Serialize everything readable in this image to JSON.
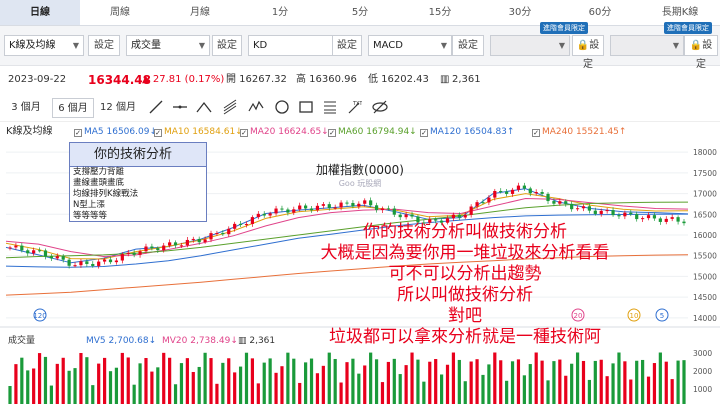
{
  "tabs": [
    {
      "label": "日線",
      "active": true
    },
    {
      "label": "周線",
      "active": false
    },
    {
      "label": "月線",
      "active": false
    },
    {
      "label": "1分",
      "active": false
    },
    {
      "label": "5分",
      "active": false
    },
    {
      "label": "15分",
      "active": false
    },
    {
      "label": "30分",
      "active": false
    },
    {
      "label": "60分",
      "active": false
    },
    {
      "label": "長期K線",
      "active": false
    }
  ],
  "selectors": {
    "s1": "K線及均線",
    "s2": "成交量",
    "s3": "KD",
    "s4": "MACD",
    "setting": "設定",
    "member_badge": "進階會員限定"
  },
  "quote": {
    "date": "2023-09-22",
    "price": "16344.48",
    "change": "▲ 27.81 (0.17%)",
    "open": "開 16267.32",
    "high": "高 16360.96",
    "low": "低 16202.43",
    "volume": "2,361"
  },
  "ranges": [
    "3 個月",
    "6 個月",
    "12 個月"
  ],
  "ma": {
    "label": "K線及均線",
    "items": [
      {
        "text": "MA5 16506.09↓",
        "color": "#2f6fd0"
      },
      {
        "text": "MA10 16584.61↓",
        "color": "#e0a010"
      },
      {
        "text": "MA20 16624.65↓",
        "color": "#e0448a"
      },
      {
        "text": "MA60 16794.94↓",
        "color": "#5aa02c"
      },
      {
        "text": "MA120 16504.83↑",
        "color": "#2f6fd0"
      },
      {
        "text": "MA240 15521.45↑",
        "color": "#e8703a"
      }
    ]
  },
  "dropdown": {
    "header": "你的技術分析",
    "items": [
      "支撐壓力背離",
      "畫線畫頭畫底",
      "均線排列K線戰法",
      "N型上漲",
      "等等等等"
    ]
  },
  "chart_title": "加權指數(0000)",
  "watermark": "Goo 玩股網",
  "volume_panel": {
    "label": "成交量",
    "mv5": "MV5 2,700.68↓",
    "mv20": "MV20 2,738.49↓",
    "vol": "2,361"
  },
  "overlay": [
    "你的技術分析叫做技術分析",
    "大概是因為要你用一堆垃圾來分析看看",
    "可不可以分析出趨勢",
    "所以叫做技術分析",
    "對吧",
    "垃圾都可以拿來分析就是一種技術阿"
  ],
  "colors": {
    "up": "#e8001c",
    "down": "#1a9a3a",
    "tab_active": "#dfe6f2"
  },
  "chart_data": {
    "type": "line",
    "y_ticks": [
      14000,
      14500,
      15000,
      15500,
      16000,
      16500,
      17000,
      17500,
      18000
    ],
    "ylim": [
      13900,
      18100
    ],
    "volume_ticks": [
      3000,
      2000,
      1000
    ],
    "markers": [
      {
        "label": "120",
        "color": "#2f6fd0"
      },
      {
        "label": "20",
        "color": "#e0448a"
      },
      {
        "label": "10",
        "color": "#e0a010"
      },
      {
        "label": "5",
        "color": "#2f6fd0"
      }
    ],
    "series": [
      {
        "name": "MA5",
        "values": [
          15700,
          15520,
          15330,
          15440,
          15660,
          15720,
          15900,
          16180,
          16520,
          16600,
          16660,
          16720,
          16560,
          16380,
          16420,
          17000,
          17120,
          16800,
          16640,
          16560,
          16540,
          16510
        ]
      },
      {
        "name": "MA10",
        "values": [
          15800,
          15650,
          15430,
          15420,
          15600,
          15730,
          15880,
          16100,
          16400,
          16560,
          16620,
          16680,
          16600,
          16440,
          16480,
          16860,
          17000,
          16880,
          16720,
          16620,
          16580,
          16585
        ]
      },
      {
        "name": "MA20",
        "values": [
          15850,
          15780,
          15600,
          15480,
          15520,
          15650,
          15800,
          15980,
          16220,
          16420,
          16540,
          16600,
          16620,
          16540,
          16520,
          16700,
          16880,
          16860,
          16780,
          16700,
          16640,
          16625
        ]
      },
      {
        "name": "MA60",
        "values": [
          15450,
          15480,
          15500,
          15520,
          15560,
          15620,
          15700,
          15800,
          15900,
          16000,
          16100,
          16200,
          16300,
          16380,
          16460,
          16560,
          16660,
          16720,
          16760,
          16780,
          16790,
          16795
        ]
      },
      {
        "name": "MA120",
        "values": [
          15250,
          15230,
          15220,
          15240,
          15300,
          15380,
          15500,
          15640,
          15780,
          15920,
          16020,
          16120,
          16220,
          16300,
          16360,
          16420,
          16460,
          16480,
          16490,
          16495,
          16500,
          16505
        ]
      },
      {
        "name": "MA240",
        "values": [
          14550,
          14580,
          14620,
          14680,
          14740,
          14800,
          14860,
          14930,
          15000,
          15070,
          15130,
          15190,
          15250,
          15300,
          15340,
          15380,
          15420,
          15450,
          15480,
          15500,
          15515,
          15521
        ]
      }
    ],
    "candles": [
      15700,
      15560,
      15280,
      15350,
      15620,
      15760,
      15900,
      16200,
      16550,
      16640,
      16700,
      16780,
      16520,
      16300,
      16450,
      16980,
      17150,
      16780,
      16600,
      16500,
      16400,
      16344
    ]
  }
}
